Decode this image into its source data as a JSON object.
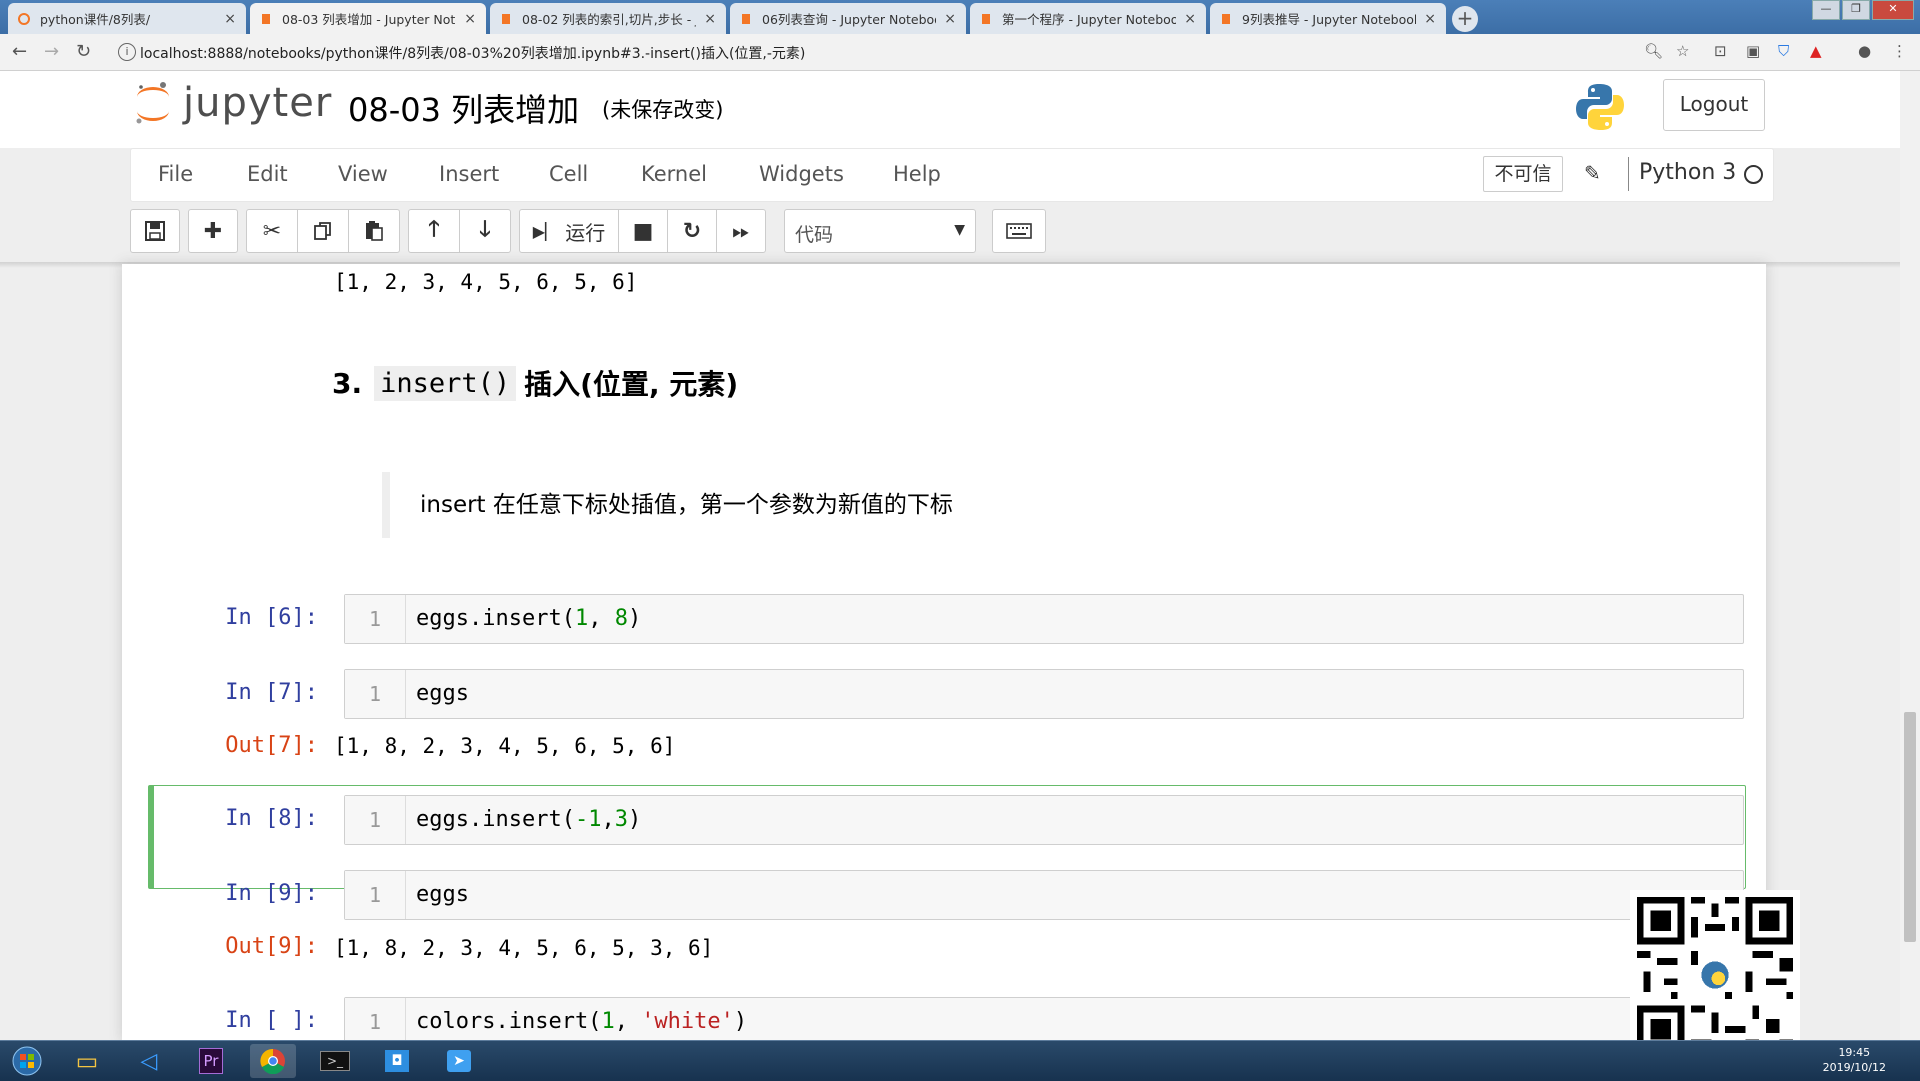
{
  "browser": {
    "tabs": [
      {
        "title": "python课件/8列表/",
        "active": false
      },
      {
        "title": "08-03 列表增加 - Jupyter Notel",
        "active": true
      },
      {
        "title": "08-02 列表的索引,切片,步长 - J",
        "active": false
      },
      {
        "title": "06列表查询 - Jupyter Noteboo",
        "active": false
      },
      {
        "title": "第一个程序 - Jupyter Notebook",
        "active": false
      },
      {
        "title": "9列表推导 - Jupyter Notebook",
        "active": false
      }
    ],
    "close_glyph": "×",
    "new_tab_glyph": "+",
    "url": "localhost:8888/notebooks/python课件/8列表/08-03%20列表增加.ipynb#3.-insert()插入(位置,-元素)"
  },
  "header": {
    "logo_text": "jupyter",
    "notebook_title": "08-03 列表增加",
    "save_status": "(未保存改变)",
    "logout_label": "Logout"
  },
  "menubar": {
    "items": [
      "File",
      "Edit",
      "View",
      "Insert",
      "Cell",
      "Kernel",
      "Widgets",
      "Help"
    ],
    "trust_label": "不可信",
    "kernel_name": "Python 3"
  },
  "toolbar": {
    "run_label": "运行",
    "cell_type": "代码"
  },
  "notebook": {
    "prev_output": "[1, 2, 3, 4, 5, 6, 5, 6]",
    "heading_number": "3.",
    "heading_code": "insert()",
    "heading_text": "插入(位置, 元素)",
    "quote": "insert 在任意下标处插值，第一个参数为新值的下标",
    "cells": [
      {
        "prompt": "In  [6]:",
        "line": "1",
        "code": "eggs.insert(1, 8)"
      },
      {
        "prompt": "In  [7]:",
        "line": "1",
        "code": "eggs",
        "out_prompt": "Out[7]:",
        "output": "[1, 8, 2, 3, 4, 5, 6, 5, 6]"
      },
      {
        "prompt": "In  [8]:",
        "line": "1",
        "code": "eggs.insert(-1,3)"
      },
      {
        "prompt": "In  [9]:",
        "line": "1",
        "code": "eggs",
        "out_prompt": "Out[9]:",
        "output": "[1, 8, 2, 3, 4, 5, 6, 5, 3, 6]"
      },
      {
        "prompt": "In  [ ]:",
        "line": "1",
        "code": "colors.insert(1, 'white')"
      }
    ]
  },
  "taskbar": {
    "time": "19:45",
    "date": "2019/10/12"
  },
  "colors": {
    "selected_cell_border": "#66bb6a",
    "in_prompt": "#303f9f",
    "out_prompt": "#d84315",
    "jupyter_orange": "#f37626"
  }
}
